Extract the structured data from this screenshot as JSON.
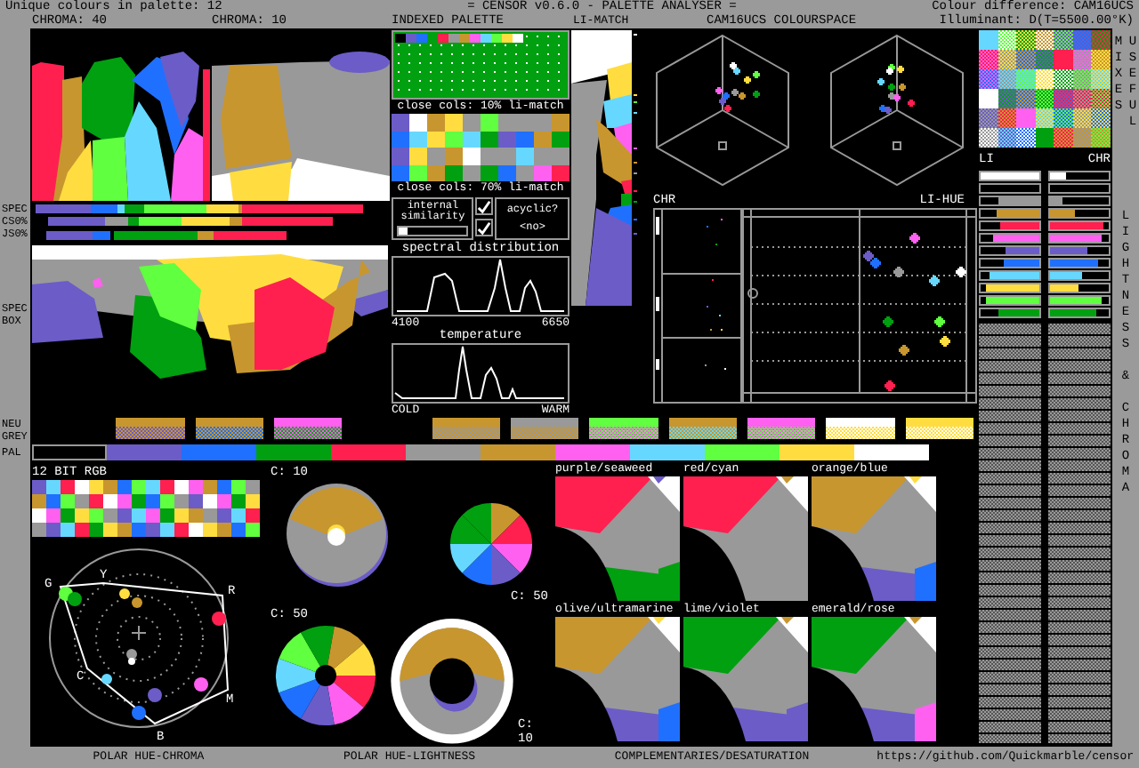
{
  "header": {
    "unique_colours": "Unique colours in palette: 12",
    "title": "= CENSOR v0.6.0 - PALETTE ANALYSER =",
    "colour_difference": "Colour difference: CAM16UCS",
    "illuminant": "Illuminant: D(T=5500.00°K)"
  },
  "panel_titles": {
    "chroma_40": "CHROMA: 40",
    "chroma_10": "CHROMA: 10",
    "indexed_palette": "INDEXED PALETTE",
    "li_match": "LI-MATCH",
    "colourspace": "CAM16UCS COLOURSPACE"
  },
  "palette": [
    {
      "color": "#000000"
    },
    {
      "color": "#6b5cc8",
      "neutral_mix": {
        "color": "#c8962e"
      }
    },
    {
      "color": "#2070ff",
      "neutral_mix": {
        "color": "#c8962e"
      }
    },
    {
      "color": "#00a010",
      "neutral_mix": {
        "color": "#ff60f0"
      }
    },
    {
      "color": "#ff2050"
    },
    {
      "color": "#999999",
      "neutral_mix": {
        "color": "#c8962e"
      }
    },
    {
      "color": "#c8962e",
      "neutral_mix": {
        "color": "#999999"
      }
    },
    {
      "color": "#ff60f0",
      "neutral_mix": {
        "color": "#60ff40"
      }
    },
    {
      "color": "#66d8ff",
      "neutral_mix": {
        "color": "#c8962e"
      }
    },
    {
      "color": "#60ff40",
      "neutral_mix": {
        "color": "#ff60f0"
      }
    },
    {
      "color": "#ffdd40",
      "neutral_mix": {
        "color": "#ffffff"
      }
    },
    {
      "color": "#ffffff",
      "neutral_mix": {
        "color": "#ffdd40"
      }
    }
  ],
  "row_labels": {
    "spec": "SPEC",
    "cs0": "CS0%",
    "js0": "JS0%",
    "spec_box": "SPEC BOX",
    "neutral_grey": "NEU GREY",
    "pal": "PAL"
  },
  "close_colours": [
    {
      "label": "close cols: 10% li-match",
      "pairs": [
        [
          {
            "color": "#6b5cc8"
          },
          {
            "color": "#2070ff"
          }
        ],
        [
          {
            "color": "#ffffff"
          },
          {
            "color": "#66d8ff"
          }
        ],
        [
          {
            "color": "#c8962e"
          },
          {
            "color": "#ffdd40"
          }
        ],
        [
          {
            "color": "#ffdd40"
          },
          {
            "color": "#60ff40"
          }
        ],
        [
          {
            "color": "#999999"
          },
          {
            "color": "#66d8ff"
          }
        ],
        [
          {
            "color": "#60ff40"
          },
          {
            "color": "#00a010"
          }
        ],
        [
          {
            "color": "#999999"
          },
          {
            "color": "#6b5cc8"
          }
        ],
        [
          {
            "color": "#999999"
          },
          {
            "color": "#2070ff"
          }
        ],
        [
          {
            "color": "#999999"
          },
          {
            "color": "#c8962e"
          }
        ],
        [
          {
            "color": "#c8962e"
          },
          {
            "color": "#00a010"
          }
        ]
      ]
    },
    {
      "label": "close cols: 70% li-match",
      "pairs": [
        [
          {
            "color": "#6b5cc8"
          },
          {
            "color": "#2070ff"
          }
        ],
        [
          {
            "color": "#ffdd40"
          },
          {
            "color": "#60ff40"
          }
        ],
        [
          {
            "color": "#999999"
          },
          {
            "color": "#c8962e"
          }
        ],
        [
          {
            "color": "#c8962e"
          },
          {
            "color": "#00a010"
          }
        ],
        [
          {
            "color": "#ffffff"
          },
          {
            "color": "#999999"
          }
        ],
        [
          {
            "color": "#999999"
          },
          {
            "color": "#00a010"
          }
        ],
        [
          {
            "color": "#999999"
          },
          {
            "color": "#2070ff"
          }
        ],
        [
          {
            "color": "#66d8ff"
          },
          {
            "color": "#999999"
          }
        ],
        [
          {
            "color": "#999999"
          },
          {
            "color": "#ff60f0"
          }
        ],
        [
          {
            "color": "#999999"
          },
          {
            "color": "#ff2050"
          }
        ]
      ]
    }
  ],
  "options": {
    "internal_similarity": {
      "label": "internal similarity",
      "checked": true,
      "level": 0.12
    },
    "acyclic": {
      "label": "acyclic?",
      "checked": true,
      "value": "<no>"
    }
  },
  "spectral": {
    "title": "spectral distribution",
    "min": "4100",
    "max": "6650"
  },
  "temperature": {
    "title": "temperature",
    "min": "COLD",
    "max": "WARM"
  },
  "plot_labels": {
    "chroma": "CHR",
    "lightness_hue": "LI-HUE"
  },
  "lightness_chroma": {
    "li": "LI",
    "chr": "CHR",
    "rows": [
      {
        "color": "#ffffff",
        "lightness": {
          "level": 1
        },
        "chroma": {
          "level": 0.28
        }
      },
      {
        "color": "#000000",
        "lightness": {
          "level": 0
        },
        "chroma": {
          "level": 0
        }
      },
      {
        "color": "#999999",
        "lightness": {
          "level": 0.7
        },
        "chroma": {
          "level": 0.2
        }
      },
      {
        "color": "#c8962e",
        "lightness": {
          "level": 0.73
        },
        "chroma": {
          "level": 0.42
        }
      },
      {
        "color": "#ff2050",
        "lightness": {
          "level": 0.67
        },
        "chroma": {
          "level": 0.9
        }
      },
      {
        "color": "#ff60f0",
        "lightness": {
          "level": 0.78
        },
        "chroma": {
          "level": 0.87
        }
      },
      {
        "color": "#6b5cc8",
        "lightness": {
          "level": 0.57
        },
        "chroma": {
          "level": 0.65
        }
      },
      {
        "color": "#2070ff",
        "lightness": {
          "level": 0.6
        },
        "chroma": {
          "level": 0.82
        }
      },
      {
        "color": "#66d8ff",
        "lightness": {
          "level": 0.86
        },
        "chroma": {
          "level": 0.55
        }
      },
      {
        "color": "#ffdd40",
        "lightness": {
          "level": 0.9
        },
        "chroma": {
          "level": 0.48
        }
      },
      {
        "color": "#60ff40",
        "lightness": {
          "level": 0.91
        },
        "chroma": {
          "level": 0.87
        }
      },
      {
        "color": "#00a010",
        "lightness": {
          "level": 0.7
        },
        "chroma": {
          "level": 0.78
        }
      }
    ]
  },
  "side_titles": {
    "mixes": "USEFUL MIXES",
    "lightness_chroma": "LIGHTNESS & CHROMA"
  },
  "rgb_title": "12 BIT RGB",
  "hue_letters": [
    "G",
    "Y",
    "R",
    "C",
    "M",
    "B"
  ],
  "lightness_discs": [
    "C: 10",
    "C: 50",
    "C: 50",
    "C: 10"
  ],
  "complementaries": [
    "purple/seaweed",
    "red/cyan",
    "orange/blue",
    "olive/ultramarine",
    "lime/violet",
    "emerald/rose"
  ],
  "footer": {
    "polar_chroma": "POLAR HUE-CHROMA",
    "polar_lightness": "POLAR HUE-LIGHTNESS",
    "complementaries": "COMPLEMENTARIES/DESATURATION",
    "url": "https://github.com/Quickmarble/censor"
  }
}
